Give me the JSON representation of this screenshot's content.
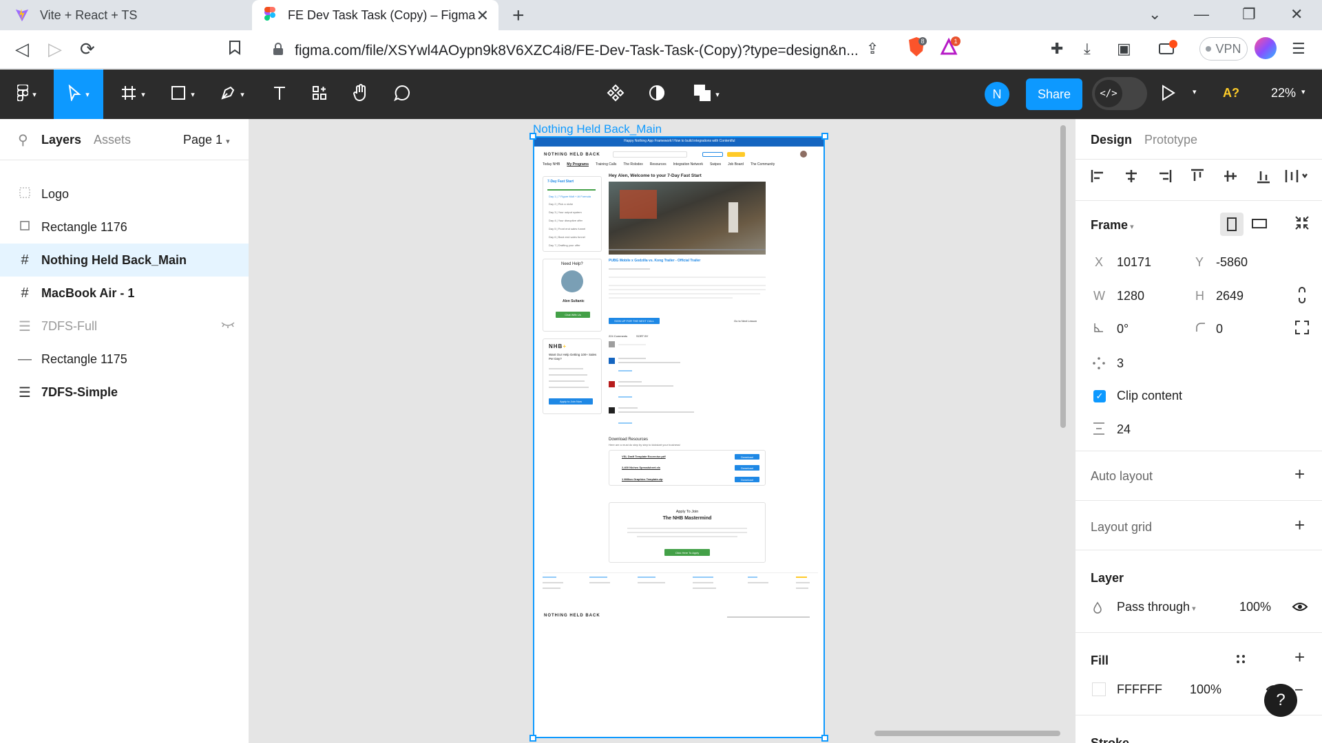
{
  "browser": {
    "tabs": [
      {
        "title": "Vite + React + TS",
        "active": false
      },
      {
        "title": "FE Dev Task Task (Copy) – Figma",
        "active": true
      }
    ],
    "url": "figma.com/file/XSYwl4AOypn9k8V6XZC4i8/FE-Dev-Task-Task-(Copy)?type=design&n...",
    "vpn_label": "VPN",
    "brave_badge": "8",
    "alert_badge": "1"
  },
  "toolbar": {
    "avatar_initial": "N",
    "share_label": "Share",
    "devmode_label": "</>",
    "a11y_label": "A?",
    "zoom": "22%"
  },
  "left_panel": {
    "tabs": [
      "Layers",
      "Assets"
    ],
    "page_selector": "Page 1",
    "layers": [
      {
        "name": "Logo",
        "icon": "dotted-frame-icon",
        "selected": false,
        "muted": false
      },
      {
        "name": "Rectangle 1176",
        "icon": "rectangle-icon",
        "selected": false,
        "muted": false
      },
      {
        "name": "Nothing Held Back_Main",
        "icon": "frame-icon",
        "selected": true,
        "muted": false
      },
      {
        "name": "MacBook Air - 1",
        "icon": "frame-icon",
        "selected": false,
        "muted": false
      },
      {
        "name": "7DFS-Full",
        "icon": "auto-layout-icon",
        "selected": false,
        "muted": true
      },
      {
        "name": "Rectangle 1175",
        "icon": "line-icon",
        "selected": false,
        "muted": false
      },
      {
        "name": "7DFS-Simple",
        "icon": "auto-layout-icon",
        "selected": false,
        "muted": false
      }
    ]
  },
  "canvas": {
    "frame_label": "Nothing Held Back_Main",
    "preview": {
      "banner": "Happy Nothing App Framework! How to build integrations with Contentful",
      "logo": "NOTHING HELD BACK",
      "nav": [
        "Today NHB",
        "My Programs",
        "Training Calls",
        "The Rolodex",
        "Resources",
        "Integration Network",
        "Swipes",
        "Job Board",
        "The Community"
      ],
      "sidebar_title": "7-Day Fast Start",
      "lessons": [
        "Day 1 | 7 Figure Mult + AI Formula",
        "Day 2 | Pick a niche",
        "Day 3 | Your output system",
        "Day 4 | Your disruptive offer",
        "Day 5 | Front end sales funnel",
        "Day 6 | Back end sales funnel",
        "Day 7 | Drafting your offer"
      ],
      "need_help": "Need Help?",
      "coach_name": "Alen Sultanic",
      "chat_btn": "Chat With Us",
      "nhb_promo_title": "Want Our Help Getting 100+ Sales Per Day?",
      "apply_btn": "Apply to Join Now",
      "welcome": "Hey Alen, Welcome to your 7-Day Fast Start",
      "video_title": "PUBG Mobile x Godzilla vs. Kong Trailer - Official Trailer",
      "signup_btn": "SIGN UP FOR THE NEXT CALL",
      "next_lesson": "Go to Next Lesson",
      "comments_count": "224 Comments",
      "sort_by": "SORT BY",
      "downloads_title": "Download Resources",
      "downloads_sub": "Here are a must do step by step to kickstart your business!",
      "downloads": [
        "VSL Draft Template Excercise.pdf",
        "2,400 Niches Spreadsheet.xls",
        "1 Million Graphics Template.zip"
      ],
      "download_btn": "Download",
      "mastermind_kicker": "Apply To Join",
      "mastermind_title": "The NHB Mastermind",
      "mastermind_btn": "Click Here To Apply",
      "footer_logo": "NOTHING HELD BACK"
    }
  },
  "right_panel": {
    "tabs": [
      "Design",
      "Prototype"
    ],
    "frame_label": "Frame",
    "x_label": "X",
    "x": "10171",
    "y_label": "Y",
    "y": "-5860",
    "w_label": "W",
    "w": "1280",
    "h_label": "H",
    "h": "2649",
    "rotation": "0°",
    "radius": "0",
    "spacing": "3",
    "clip_label": "Clip content",
    "gap": "24",
    "auto_layout": "Auto layout",
    "layout_grid": "Layout grid",
    "layer_title": "Layer",
    "blend": "Pass through",
    "opacity": "100%",
    "fill_title": "Fill",
    "fill_hex": "FFFFFF",
    "fill_opacity": "100%",
    "stroke_title": "Stroke",
    "help": "?"
  },
  "colors": {
    "figma_blue": "#0d99ff",
    "toolbar_bg": "#2c2c2c",
    "canvas_bg": "#e5e5e5",
    "selected_row": "#e5f4ff"
  }
}
